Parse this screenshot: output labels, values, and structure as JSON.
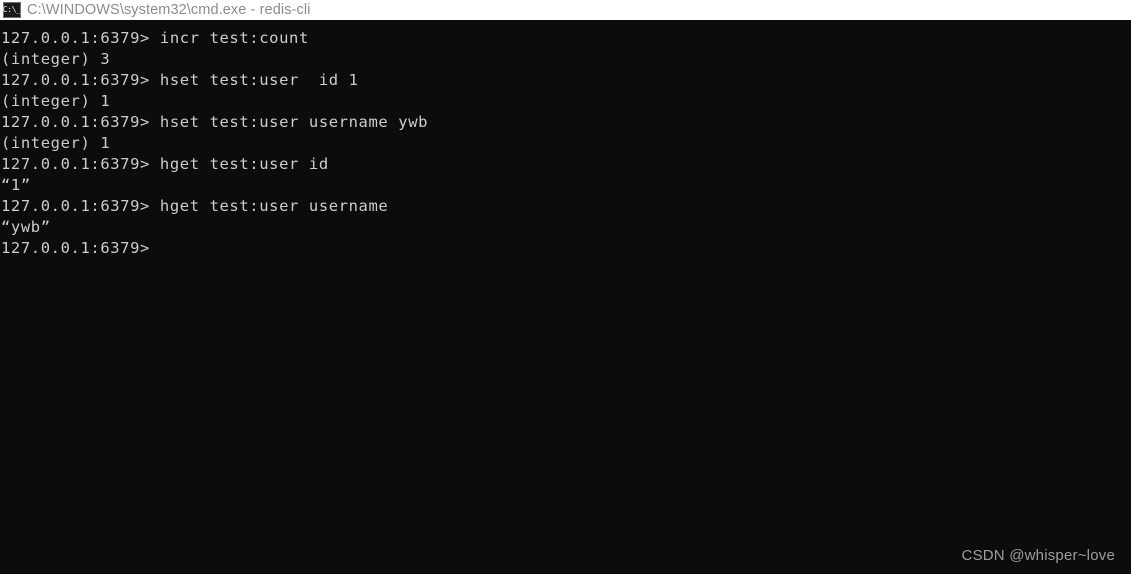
{
  "window": {
    "title": "C:\\WINDOWS\\system32\\cmd.exe - redis-cli",
    "icon": "cmd-console-icon",
    "icon_glyph": "C:\\_",
    "titlebar_bg": "#ffffff",
    "title_color": "#8c8c8c",
    "console_bg": "#0c0c0c",
    "console_fg": "#cccccc"
  },
  "terminal": {
    "prompt": "127.0.0.1:6379>",
    "lines": [
      "127.0.0.1:6379> incr test:count",
      "(integer) 3",
      "127.0.0.1:6379> hset test:user  id 1",
      "(integer) 1",
      "127.0.0.1:6379> hset test:user username ywb",
      "(integer) 1",
      "127.0.0.1:6379> hget test:user id",
      "“1”",
      "127.0.0.1:6379> hget test:user username",
      "“ywb”",
      "127.0.0.1:6379>"
    ]
  },
  "watermark": {
    "text": "CSDN @whisper~love",
    "color": "#9d9d9d"
  }
}
